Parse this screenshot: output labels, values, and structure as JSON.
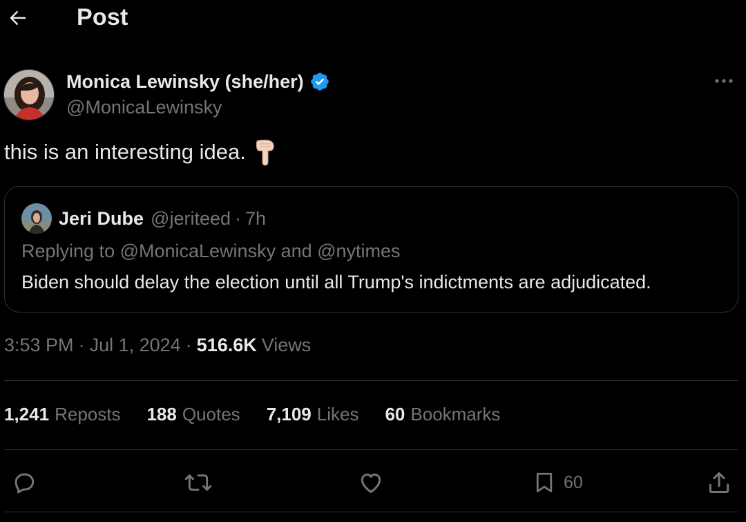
{
  "header": {
    "title": "Post",
    "back_icon": "arrow-left-icon"
  },
  "author": {
    "name": "Monica Lewinsky (she/her)",
    "handle": "@MonicaLewinsky",
    "verified": true,
    "verified_color": "#1d9bf0"
  },
  "post": {
    "text": "this is an interesting idea.",
    "emoji": "backhand-index-pointing-down"
  },
  "quote": {
    "name": "Jeri Dube",
    "handle": "@jeriteed",
    "dot": "·",
    "time": "7h",
    "reply_line": "Replying to @MonicaLewinsky and @nytimes",
    "body": "Biden should delay the election until all Trump's indictments are adjudicated."
  },
  "meta": {
    "time": "3:53 PM",
    "sep1": "·",
    "date": "Jul 1, 2024",
    "sep2": "·",
    "views_count": "516.6K",
    "views_label": "Views"
  },
  "stats": {
    "reposts_count": "1,241",
    "reposts_label": "Reposts",
    "quotes_count": "188",
    "quotes_label": "Quotes",
    "likes_count": "7,109",
    "likes_label": "Likes",
    "bookmarks_count": "60",
    "bookmarks_label": "Bookmarks"
  },
  "actions": {
    "bookmark_count": "60",
    "icons": [
      "reply-icon",
      "repost-icon",
      "like-icon",
      "bookmark-icon",
      "share-icon"
    ]
  },
  "colors": {
    "background": "#000000",
    "primary_text": "#e7e9ea",
    "secondary_text": "#71767b",
    "border": "#2f3336",
    "accent": "#1d9bf0"
  }
}
